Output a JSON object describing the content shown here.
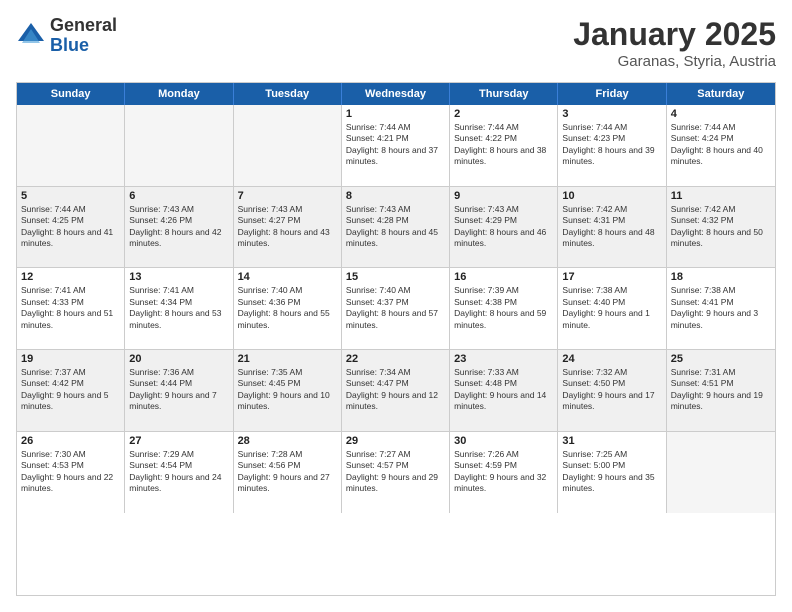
{
  "logo": {
    "general": "General",
    "blue": "Blue"
  },
  "title": "January 2025",
  "location": "Garanas, Styria, Austria",
  "days": [
    "Sunday",
    "Monday",
    "Tuesday",
    "Wednesday",
    "Thursday",
    "Friday",
    "Saturday"
  ],
  "weeks": [
    [
      {
        "day": "",
        "text": ""
      },
      {
        "day": "",
        "text": ""
      },
      {
        "day": "",
        "text": ""
      },
      {
        "day": "1",
        "text": "Sunrise: 7:44 AM\nSunset: 4:21 PM\nDaylight: 8 hours and 37 minutes."
      },
      {
        "day": "2",
        "text": "Sunrise: 7:44 AM\nSunset: 4:22 PM\nDaylight: 8 hours and 38 minutes."
      },
      {
        "day": "3",
        "text": "Sunrise: 7:44 AM\nSunset: 4:23 PM\nDaylight: 8 hours and 39 minutes."
      },
      {
        "day": "4",
        "text": "Sunrise: 7:44 AM\nSunset: 4:24 PM\nDaylight: 8 hours and 40 minutes."
      }
    ],
    [
      {
        "day": "5",
        "text": "Sunrise: 7:44 AM\nSunset: 4:25 PM\nDaylight: 8 hours and 41 minutes."
      },
      {
        "day": "6",
        "text": "Sunrise: 7:43 AM\nSunset: 4:26 PM\nDaylight: 8 hours and 42 minutes."
      },
      {
        "day": "7",
        "text": "Sunrise: 7:43 AM\nSunset: 4:27 PM\nDaylight: 8 hours and 43 minutes."
      },
      {
        "day": "8",
        "text": "Sunrise: 7:43 AM\nSunset: 4:28 PM\nDaylight: 8 hours and 45 minutes."
      },
      {
        "day": "9",
        "text": "Sunrise: 7:43 AM\nSunset: 4:29 PM\nDaylight: 8 hours and 46 minutes."
      },
      {
        "day": "10",
        "text": "Sunrise: 7:42 AM\nSunset: 4:31 PM\nDaylight: 8 hours and 48 minutes."
      },
      {
        "day": "11",
        "text": "Sunrise: 7:42 AM\nSunset: 4:32 PM\nDaylight: 8 hours and 50 minutes."
      }
    ],
    [
      {
        "day": "12",
        "text": "Sunrise: 7:41 AM\nSunset: 4:33 PM\nDaylight: 8 hours and 51 minutes."
      },
      {
        "day": "13",
        "text": "Sunrise: 7:41 AM\nSunset: 4:34 PM\nDaylight: 8 hours and 53 minutes."
      },
      {
        "day": "14",
        "text": "Sunrise: 7:40 AM\nSunset: 4:36 PM\nDaylight: 8 hours and 55 minutes."
      },
      {
        "day": "15",
        "text": "Sunrise: 7:40 AM\nSunset: 4:37 PM\nDaylight: 8 hours and 57 minutes."
      },
      {
        "day": "16",
        "text": "Sunrise: 7:39 AM\nSunset: 4:38 PM\nDaylight: 8 hours and 59 minutes."
      },
      {
        "day": "17",
        "text": "Sunrise: 7:38 AM\nSunset: 4:40 PM\nDaylight: 9 hours and 1 minute."
      },
      {
        "day": "18",
        "text": "Sunrise: 7:38 AM\nSunset: 4:41 PM\nDaylight: 9 hours and 3 minutes."
      }
    ],
    [
      {
        "day": "19",
        "text": "Sunrise: 7:37 AM\nSunset: 4:42 PM\nDaylight: 9 hours and 5 minutes."
      },
      {
        "day": "20",
        "text": "Sunrise: 7:36 AM\nSunset: 4:44 PM\nDaylight: 9 hours and 7 minutes."
      },
      {
        "day": "21",
        "text": "Sunrise: 7:35 AM\nSunset: 4:45 PM\nDaylight: 9 hours and 10 minutes."
      },
      {
        "day": "22",
        "text": "Sunrise: 7:34 AM\nSunset: 4:47 PM\nDaylight: 9 hours and 12 minutes."
      },
      {
        "day": "23",
        "text": "Sunrise: 7:33 AM\nSunset: 4:48 PM\nDaylight: 9 hours and 14 minutes."
      },
      {
        "day": "24",
        "text": "Sunrise: 7:32 AM\nSunset: 4:50 PM\nDaylight: 9 hours and 17 minutes."
      },
      {
        "day": "25",
        "text": "Sunrise: 7:31 AM\nSunset: 4:51 PM\nDaylight: 9 hours and 19 minutes."
      }
    ],
    [
      {
        "day": "26",
        "text": "Sunrise: 7:30 AM\nSunset: 4:53 PM\nDaylight: 9 hours and 22 minutes."
      },
      {
        "day": "27",
        "text": "Sunrise: 7:29 AM\nSunset: 4:54 PM\nDaylight: 9 hours and 24 minutes."
      },
      {
        "day": "28",
        "text": "Sunrise: 7:28 AM\nSunset: 4:56 PM\nDaylight: 9 hours and 27 minutes."
      },
      {
        "day": "29",
        "text": "Sunrise: 7:27 AM\nSunset: 4:57 PM\nDaylight: 9 hours and 29 minutes."
      },
      {
        "day": "30",
        "text": "Sunrise: 7:26 AM\nSunset: 4:59 PM\nDaylight: 9 hours and 32 minutes."
      },
      {
        "day": "31",
        "text": "Sunrise: 7:25 AM\nSunset: 5:00 PM\nDaylight: 9 hours and 35 minutes."
      },
      {
        "day": "",
        "text": ""
      }
    ]
  ]
}
